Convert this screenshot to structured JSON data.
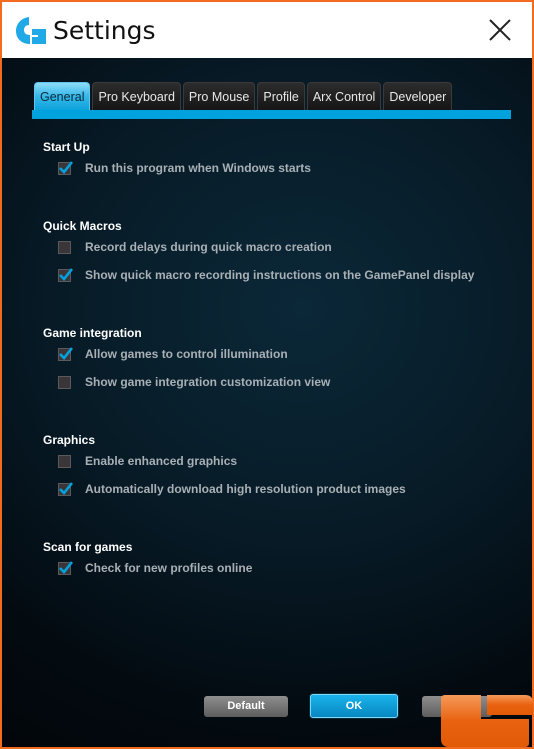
{
  "window": {
    "title": "Settings",
    "logo_icon": "logitech-g-icon",
    "close_icon": "close-icon",
    "accent_color": "#00a2dd"
  },
  "tabs": [
    {
      "label": "General",
      "active": true
    },
    {
      "label": "Pro Keyboard",
      "active": false
    },
    {
      "label": "Pro Mouse",
      "active": false
    },
    {
      "label": "Profile",
      "active": false
    },
    {
      "label": "Arx Control",
      "active": false
    },
    {
      "label": "Developer",
      "active": false
    }
  ],
  "sections": [
    {
      "title": "Start Up",
      "options": [
        {
          "label": "Run this program when Windows starts",
          "checked": true
        }
      ]
    },
    {
      "title": "Quick Macros",
      "options": [
        {
          "label": "Record delays during quick macro creation",
          "checked": false
        },
        {
          "label": "Show quick macro recording instructions on the GamePanel display",
          "checked": true
        }
      ]
    },
    {
      "title": "Game integration",
      "options": [
        {
          "label": "Allow games to control illumination",
          "checked": true
        },
        {
          "label": "Show game integration customization view",
          "checked": false
        }
      ]
    },
    {
      "title": "Graphics",
      "options": [
        {
          "label": "Enable enhanced graphics",
          "checked": false
        },
        {
          "label": "Automatically download high resolution product images",
          "checked": true
        }
      ]
    },
    {
      "title": "Scan for games",
      "options": [
        {
          "label": "Check for new profiles online",
          "checked": true
        }
      ]
    }
  ],
  "buttons": {
    "default_label": "Default",
    "ok_label": "OK",
    "cancel_label": ""
  }
}
